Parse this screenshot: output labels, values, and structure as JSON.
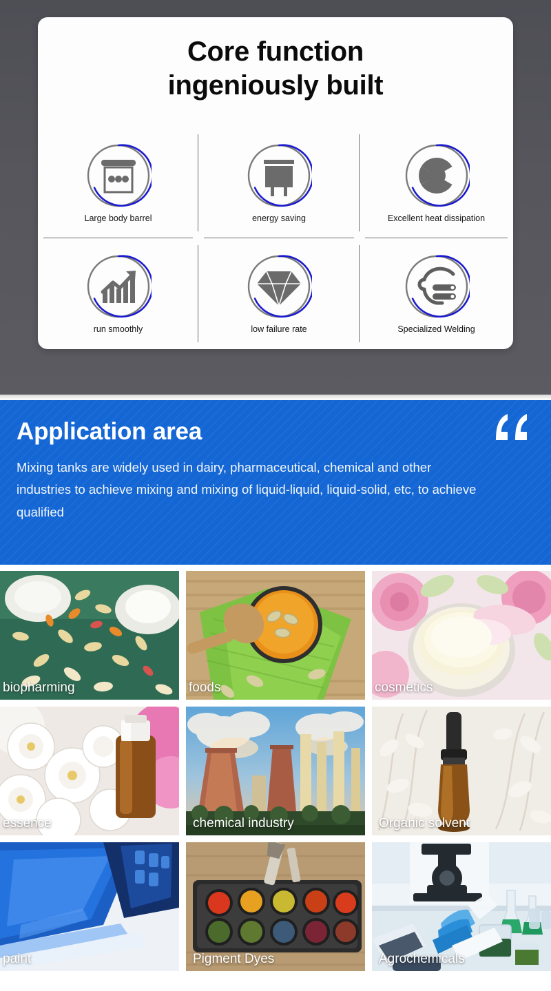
{
  "features": {
    "title_line1": "Core function",
    "title_line2": "ingeniously built",
    "items": [
      {
        "label": "Large body barrel",
        "icon": "barrel-icon"
      },
      {
        "label": "energy saving",
        "icon": "energy-saving-icon"
      },
      {
        "label": "Excellent heat dissipation",
        "icon": "fan-heat-dissipation-icon"
      },
      {
        "label": "run smoothly",
        "icon": "growth-chart-icon"
      },
      {
        "label": "low failure rate",
        "icon": "diamond-icon"
      },
      {
        "label": "Specialized Welding",
        "icon": "welding-helmet-icon"
      }
    ]
  },
  "application": {
    "title": "Application area",
    "description": "Mixing tanks are widely used in dairy, pharmaceutical, chemical and other industries to achieve mixing and mixing of liquid-liquid, liquid-solid, etc, to achieve qualified",
    "quote_icon": "quote-mark-icon",
    "tiles": [
      {
        "caption": "biopharming"
      },
      {
        "caption": "foods"
      },
      {
        "caption": "cosmetics"
      },
      {
        "caption": "essence"
      },
      {
        "caption": "chemical industry"
      },
      {
        "caption": "Organic solvent"
      },
      {
        "caption": "paint"
      },
      {
        "caption": "Pigment Dyes"
      },
      {
        "caption": "Agrochemicals"
      }
    ]
  },
  "colors": {
    "brand_blue": "#1366d4",
    "ring_blue": "#1a1ad0",
    "ring_gray": "#7b7b7b",
    "icon_gray": "#6b6b6b",
    "hero_bg": "#56565c"
  }
}
